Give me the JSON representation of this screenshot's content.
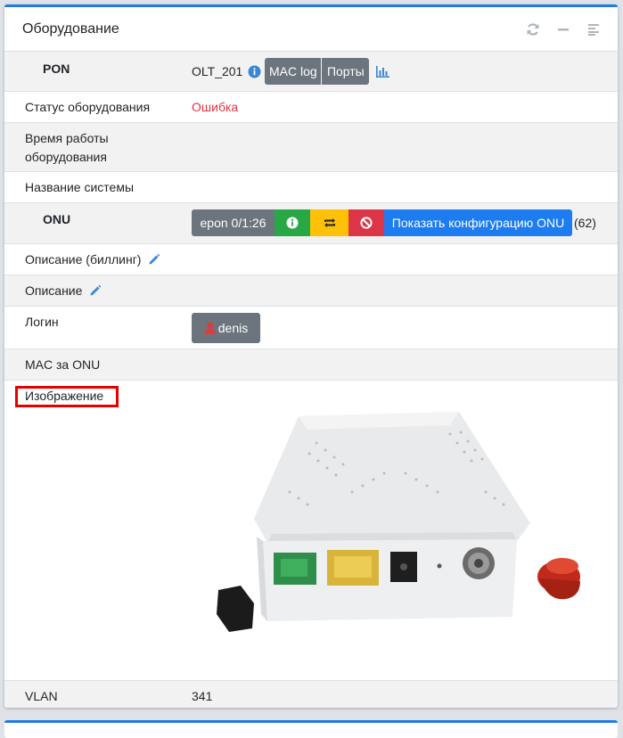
{
  "card": {
    "title": "Оборудование",
    "tools": [
      "refresh-icon",
      "minus-icon",
      "list-icon"
    ]
  },
  "pon": {
    "label": "PON",
    "value": "OLT_201",
    "mac_log_label": "MAC log",
    "ports_label": "Порты"
  },
  "status": {
    "label": "Статус оборудования",
    "value": "Ошибка"
  },
  "uptime": {
    "label": "Время работы оборудования",
    "value": ""
  },
  "sysname": {
    "label": "Название системы",
    "value": ""
  },
  "onu": {
    "label": "ONU",
    "port_label": "epon 0/1:26",
    "show_config_label": "Показать конфигурацию ONU",
    "count": "(62)"
  },
  "desc_billing": {
    "label": "Описание (биллинг)"
  },
  "desc": {
    "label": "Описание"
  },
  "login": {
    "label": "Логин",
    "user": "denis"
  },
  "mac_onu": {
    "label": "MAC за ONU"
  },
  "image": {
    "label": "Изображение"
  },
  "vlan": {
    "label": "VLAN",
    "value": "341"
  },
  "colors": {
    "accent": "#1f7be0",
    "error": "#dc3545",
    "success": "#28a745",
    "warning": "#ffc107",
    "primary": "#1c7cf0",
    "secondary": "#6c757d",
    "highlight": "#e50000"
  }
}
